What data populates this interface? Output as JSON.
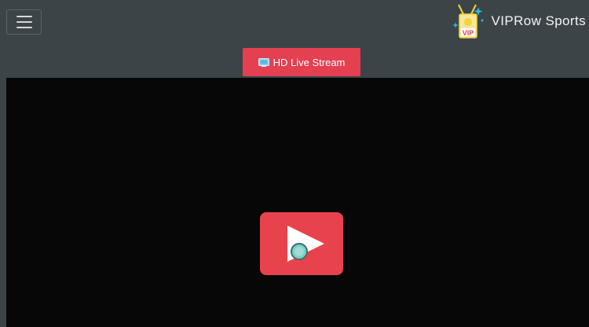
{
  "header": {
    "brand_name": "VIPRow Sports",
    "logo_text": "VIP"
  },
  "stream_button": {
    "label": "HD Live Stream",
    "icon": "tv-icon"
  },
  "player": {
    "play_icon": "play-icon"
  },
  "colors": {
    "background": "#3d4447",
    "accent_red": "#e44052",
    "player_bg": "#070707",
    "logo_yellow": "#f3d43a",
    "logo_cyan": "#25b7e8"
  }
}
